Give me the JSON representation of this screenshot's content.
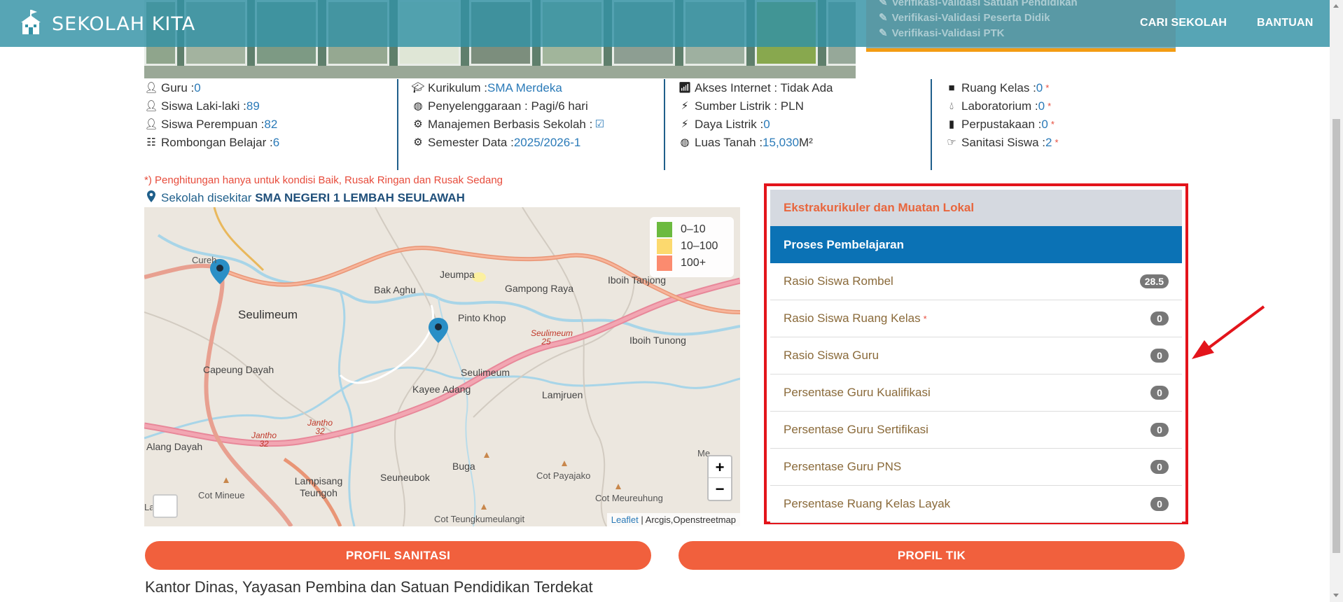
{
  "nav": {
    "brand": "SEKOLAH KITA",
    "links": [
      "CARI SEKOLAH",
      "BANTUAN"
    ],
    "verification": [
      "Verifikasi-Validasi Satuan Pendidikan",
      "Verifikasi-Validasi Peserta Didik",
      "Verifikasi-Validasi PTK"
    ]
  },
  "stats": {
    "col1": [
      {
        "label": "Guru : ",
        "value": "0",
        "icon": "user-icon"
      },
      {
        "label": "Siswa Laki-laki : ",
        "value": "89",
        "icon": "user-icon"
      },
      {
        "label": "Siswa Perempuan : ",
        "value": "82",
        "icon": "user-icon"
      },
      {
        "label": "Rombongan Belajar : ",
        "value": "6",
        "icon": "list-icon"
      }
    ],
    "col2": [
      {
        "label": "Kurikulum : ",
        "value": "SMA Merdeka",
        "icon": "graduation-cap-icon"
      },
      {
        "label": "Penyelenggaraan : Pagi/6 hari",
        "value": "",
        "icon": "globe-icon"
      },
      {
        "label": "Manajemen Berbasis Sekolah : ",
        "value": "",
        "icon": "gear-icon"
      },
      {
        "label": "Semester Data : ",
        "value": "2025/2026-1",
        "icon": "gear-icon"
      }
    ],
    "col3": [
      {
        "label": "Akses Internet : Tidak Ada",
        "value": "",
        "icon": "signal-icon"
      },
      {
        "label": "Sumber Listrik : PLN",
        "value": "",
        "icon": "bolt-icon"
      },
      {
        "label": "Daya Listrik : ",
        "value": "0",
        "icon": "bolt-icon"
      },
      {
        "label": "Luas Tanah : ",
        "value": "15,030",
        "suffix": " M²",
        "icon": "globe-icon"
      }
    ],
    "col4": [
      {
        "label": "Ruang Kelas : ",
        "value": "0",
        "star": "*",
        "icon": "square-icon"
      },
      {
        "label": "Laboratorium : ",
        "value": "0",
        "star": "*",
        "icon": "drop-icon"
      },
      {
        "label": "Perpustakaan : ",
        "value": "0",
        "star": "*",
        "icon": "book-icon"
      },
      {
        "label": "Sanitasi Siswa : ",
        "value": "2",
        "star": "*",
        "icon": "hand-icon"
      }
    ]
  },
  "footnote": "*) Penghitungan hanya untuk kondisi Baik, Rusak Ringan dan Rusak Sedang",
  "nearby": {
    "prefix": "Sekolah disekitar ",
    "school": "SMA NEGERI 1 LEMBAH SEULAWAH"
  },
  "map": {
    "legend": [
      {
        "label": "0–10",
        "color": "#6cba3f"
      },
      {
        "label": "10–100",
        "color": "#fcd96e"
      },
      {
        "label": "100+",
        "color": "#fb8b6f"
      }
    ],
    "places": [
      "Cureh",
      "Seulimeum",
      "Bak Aghu",
      "Jeumpa",
      "Gampong Raya",
      "Iboih Tanjong",
      "Pinto Khop",
      "Iboih Tunong",
      "Capeung Dayah",
      "Seulimeum",
      "Kayee Adang",
      "Lamjruen",
      "Alang Dayah",
      "Buga",
      "Seuneubok",
      "Lampisang Teungoh",
      "Cot Payajako",
      "Cot Meureuhung",
      "Cot Mineue",
      "Cot Teungkumeulangit",
      "Me",
      "La"
    ],
    "roads": [
      "Seulimeum 25",
      "Jantho 32",
      "Jantho 32"
    ],
    "zoom_in": "+",
    "zoom_out": "−",
    "attribution_link": "Leaflet",
    "attribution_text": " | Arcgis,Openstreetmap"
  },
  "panel": {
    "header1": "Ekstrakurikuler dan Muatan Lokal",
    "header2": "Proses Pembelajaran",
    "rows": [
      {
        "label": "Rasio Siswa Rombel",
        "value": "28.5",
        "star": ""
      },
      {
        "label": "Rasio Siswa Ruang Kelas",
        "value": "0",
        "star": "*"
      },
      {
        "label": "Rasio Siswa Guru",
        "value": "0",
        "star": ""
      },
      {
        "label": "Persentase Guru Kualifikasi",
        "value": "0",
        "star": ""
      },
      {
        "label": "Persentase Guru Sertifikasi",
        "value": "0",
        "star": ""
      },
      {
        "label": "Persentase Guru PNS",
        "value": "0",
        "star": ""
      },
      {
        "label": "Persentase Ruang Kelas Layak",
        "value": "0",
        "star": ""
      }
    ]
  },
  "buttons": {
    "sanitasi": "PROFIL SANITASI",
    "tik": "PROFIL TIK"
  },
  "bottom_title": "Kantor Dinas, Yayasan Pembina dan Satuan Pendidikan Terdekat"
}
